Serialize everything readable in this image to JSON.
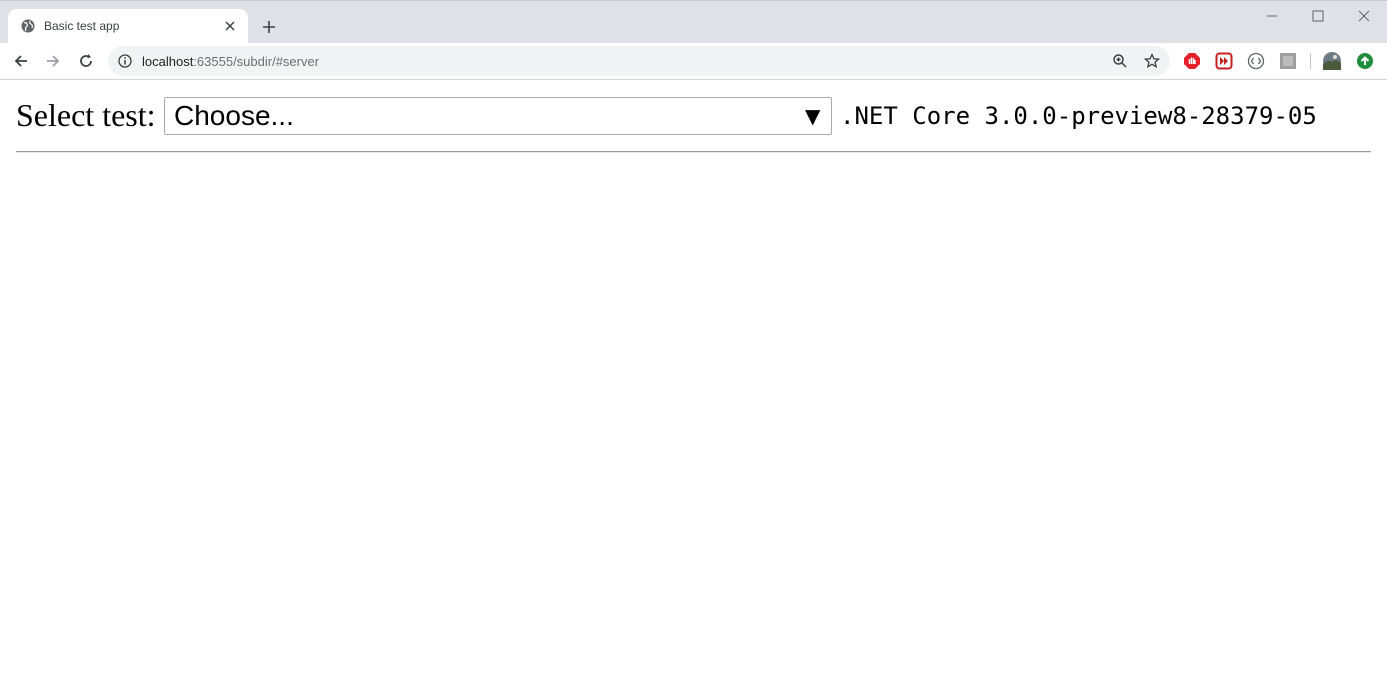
{
  "browser": {
    "tab_title": "Basic test app",
    "url_host": "localhost",
    "url_rest": ":63555/subdir/#server"
  },
  "page": {
    "select_label": "Select test:",
    "select_value": "Choose...",
    "select_arrow": "▼",
    "version_text": ".NET Core 3.0.0-preview8-28379-05"
  },
  "colors": {
    "adblock_red": "#e8202a",
    "accent_green": "#1e8e3e",
    "chrome_bg": "#dee1e6"
  }
}
